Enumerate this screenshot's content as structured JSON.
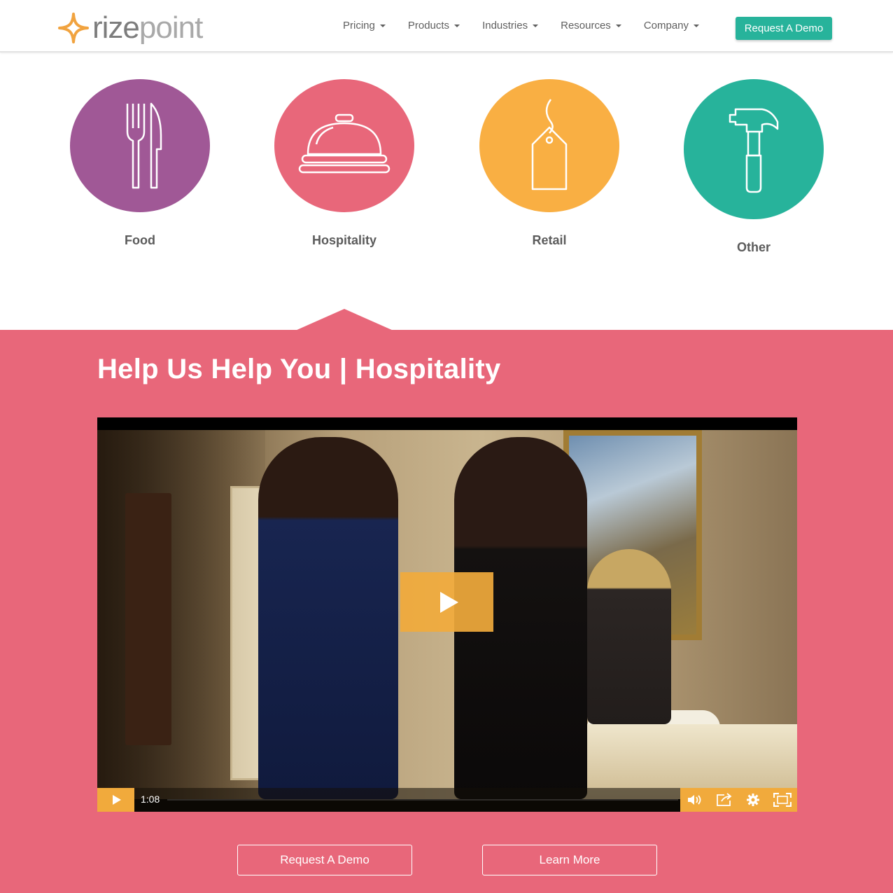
{
  "brand": {
    "logo_part1": "rize",
    "logo_part2": "point",
    "accent_orange": "#f1a33f",
    "teal": "#27b39b",
    "pink": "#e8677a"
  },
  "nav": {
    "items": [
      {
        "label": "Pricing",
        "icon": "caret-down-icon"
      },
      {
        "label": "Products",
        "icon": "caret-down-icon"
      },
      {
        "label": "Industries",
        "icon": "caret-down-icon"
      },
      {
        "label": "Resources",
        "icon": "caret-down-icon"
      },
      {
        "label": "Company",
        "icon": "caret-down-icon"
      }
    ],
    "cta_label": "Request A Demo"
  },
  "industries": [
    {
      "label": "Food",
      "icon": "fork-knife-icon",
      "color": "#a05896"
    },
    {
      "label": "Hospitality",
      "icon": "service-bell-icon",
      "color": "#e8677a"
    },
    {
      "label": "Retail",
      "icon": "price-tag-icon",
      "color": "#f9af43"
    },
    {
      "label": "Other",
      "icon": "hammer-icon",
      "color": "#27b39b"
    }
  ],
  "section": {
    "title": "Help Us Help You | Hospitality"
  },
  "video": {
    "time": "1:08",
    "controls": [
      "play-icon",
      "volume-icon",
      "share-icon",
      "settings-icon",
      "fullscreen-icon"
    ],
    "control_color": "#f1aa3c"
  },
  "cta": {
    "primary_label": "Request A Demo",
    "secondary_label": "Learn More"
  }
}
